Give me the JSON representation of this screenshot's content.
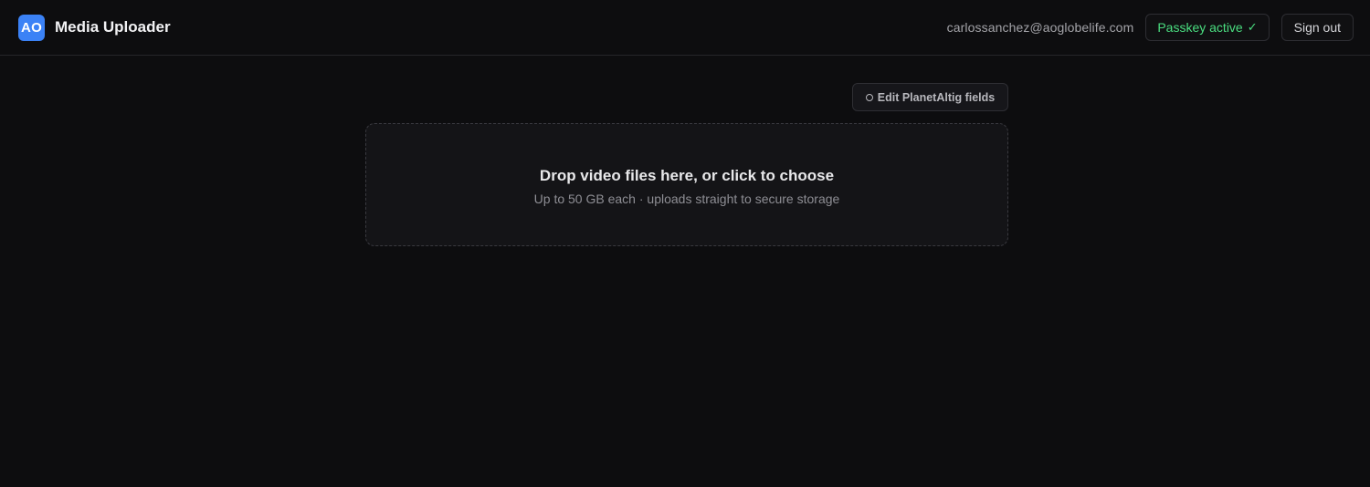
{
  "header": {
    "logo_text": "AO",
    "app_title": "Media Uploader",
    "user_email": "carlossanchez@aoglobelife.com",
    "passkey_label": "Passkey active",
    "passkey_check": "✓",
    "signout_label": "Sign out"
  },
  "toolbar": {
    "edit_fields_label": "Edit PlanetAltig fields"
  },
  "dropzone": {
    "title": "Drop video files here, or click to choose",
    "subtitle": "Up to 50 GB each · uploads straight to secure storage"
  },
  "colors": {
    "background": "#0d0d0f",
    "accent": "#3b82f6",
    "success": "#4ade80"
  }
}
